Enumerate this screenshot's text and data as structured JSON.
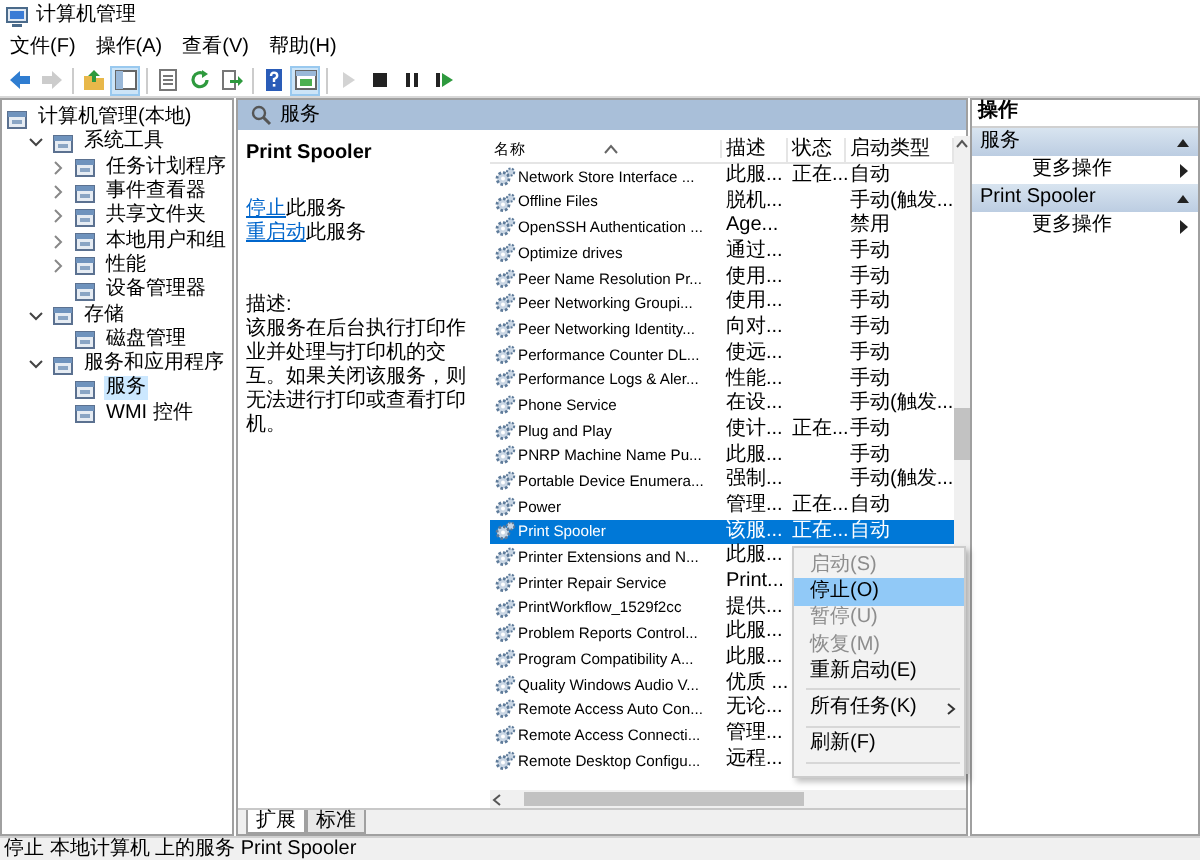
{
  "window": {
    "title": "计算机管理"
  },
  "menu": [
    "文件(F)",
    "操作(A)",
    "查看(V)",
    "帮助(H)"
  ],
  "toolbar": [
    {
      "kind": "back",
      "disabled": false,
      "pressed": false
    },
    {
      "kind": "forward",
      "disabled": true,
      "pressed": false
    },
    {
      "kind": "separator"
    },
    {
      "kind": "up",
      "disabled": false,
      "pressed": false
    },
    {
      "kind": "tree",
      "disabled": false,
      "pressed": true
    },
    {
      "kind": "separator"
    },
    {
      "kind": "properties",
      "disabled": false,
      "pressed": false
    },
    {
      "kind": "refresh",
      "disabled": false,
      "pressed": false
    },
    {
      "kind": "export",
      "disabled": false,
      "pressed": false
    },
    {
      "kind": "separator"
    },
    {
      "kind": "help",
      "disabled": false,
      "pressed": false
    },
    {
      "kind": "pane",
      "disabled": false,
      "pressed": true
    },
    {
      "kind": "separator"
    },
    {
      "kind": "start",
      "disabled": true,
      "pressed": false
    },
    {
      "kind": "stop",
      "disabled": false,
      "pressed": false
    },
    {
      "kind": "pause",
      "disabled": false,
      "pressed": false
    },
    {
      "kind": "restart",
      "disabled": false,
      "pressed": false
    }
  ],
  "tree": [
    {
      "label": "计算机管理(本地)",
      "selected": false,
      "children": [
        {
          "label": "系统工具",
          "expanded": true,
          "selected": false,
          "children": [
            {
              "label": "任务计划程序",
              "expanded": false,
              "selected": false
            },
            {
              "label": "事件查看器",
              "expanded": false,
              "selected": false
            },
            {
              "label": "共享文件夹",
              "expanded": false,
              "selected": false
            },
            {
              "label": "本地用户和组",
              "expanded": false,
              "selected": false
            },
            {
              "label": "性能",
              "expanded": false,
              "selected": false
            },
            {
              "label": "设备管理器",
              "selected": false
            }
          ]
        },
        {
          "label": "存储",
          "expanded": true,
          "selected": false,
          "children": [
            {
              "label": "磁盘管理",
              "selected": false
            }
          ]
        },
        {
          "label": "服务和应用程序",
          "expanded": true,
          "selected": false,
          "children": [
            {
              "label": "服务",
              "selected": true
            },
            {
              "label": "WMI 控件",
              "selected": false
            }
          ]
        }
      ]
    }
  ],
  "pane_title": "服务",
  "details": {
    "title": "Print Spooler",
    "actions": [
      {
        "link": "停止",
        "text": "此服务"
      },
      {
        "link": "重启动",
        "text": "此服务"
      }
    ],
    "description_label": "描述:",
    "description": "该服务在后台执行打印作业并处理与打印机的交互。如果关闭该服务，则无法进行打印或查看打印机。"
  },
  "columns": [
    "名称",
    "描述",
    "状态",
    "启动类型"
  ],
  "services": [
    {
      "name": "Network Store Interface ...",
      "description": "此服...",
      "status": "正在...",
      "startup": "自动",
      "selected": false
    },
    {
      "name": "Offline Files",
      "description": "脱机...",
      "startup": "手动(触发...",
      "selected": false
    },
    {
      "name": "OpenSSH Authentication ...",
      "description": "Age...",
      "startup": "禁用",
      "selected": false
    },
    {
      "name": "Optimize drives",
      "description": "通过...",
      "startup": "手动",
      "selected": false
    },
    {
      "name": "Peer Name Resolution Pr...",
      "description": "使用...",
      "startup": "手动",
      "selected": false
    },
    {
      "name": "Peer Networking Groupi...",
      "description": "使用...",
      "startup": "手动",
      "selected": false
    },
    {
      "name": "Peer Networking Identity...",
      "description": "向对...",
      "startup": "手动",
      "selected": false
    },
    {
      "name": "Performance Counter DL...",
      "description": "使远...",
      "startup": "手动",
      "selected": false
    },
    {
      "name": "Performance Logs & Aler...",
      "description": "性能...",
      "startup": "手动",
      "selected": false
    },
    {
      "name": "Phone Service",
      "description": "在设...",
      "startup": "手动(触发...",
      "selected": false
    },
    {
      "name": "Plug and Play",
      "description": "使计...",
      "status": "正在...",
      "startup": "手动",
      "selected": false
    },
    {
      "name": "PNRP Machine Name Pu...",
      "description": "此服...",
      "startup": "手动",
      "selected": false
    },
    {
      "name": "Portable Device Enumera...",
      "description": "强制...",
      "startup": "手动(触发...",
      "selected": false
    },
    {
      "name": "Power",
      "description": "管理...",
      "status": "正在...",
      "startup": "自动",
      "selected": false
    },
    {
      "name": "Print Spooler",
      "description": "该服...",
      "status": "正在...",
      "startup": "自动",
      "selected": true
    },
    {
      "name": "Printer Extensions and N...",
      "description": "此服...",
      "selected": false
    },
    {
      "name": "Printer Repair Service",
      "description": "Print...",
      "selected": false
    },
    {
      "name": "PrintWorkflow_1529f2cc",
      "description": "提供...",
      "selected": false
    },
    {
      "name": "Problem Reports Control...",
      "description": "此服...",
      "selected": false
    },
    {
      "name": "Program Compatibility A...",
      "description": "此服...",
      "selected": false
    },
    {
      "name": "Quality Windows Audio V...",
      "description": "优质 ...",
      "selected": false
    },
    {
      "name": "Remote Access Auto Con...",
      "description": "无论...",
      "selected": false
    },
    {
      "name": "Remote Access Connecti...",
      "description": "管理...",
      "selected": false
    },
    {
      "name": "Remote Desktop Configu...",
      "description": "远程...",
      "selected": false
    }
  ],
  "context_menu": [
    {
      "label": "启动(S)",
      "kind": "command",
      "disabled": true,
      "selected": false
    },
    {
      "label": "停止(O)",
      "kind": "command",
      "disabled": false,
      "selected": true
    },
    {
      "label": "暂停(U)",
      "kind": "command",
      "disabled": true,
      "selected": false
    },
    {
      "label": "恢复(M)",
      "kind": "command",
      "disabled": true,
      "selected": false
    },
    {
      "label": "重新启动(E)",
      "kind": "command",
      "disabled": false,
      "selected": false
    },
    {
      "kind": "separator"
    },
    {
      "label": "所有任务(K)",
      "kind": "submenu",
      "disabled": false,
      "selected": false
    },
    {
      "kind": "separator"
    },
    {
      "label": "刷新(F)",
      "kind": "command",
      "disabled": false,
      "selected": false
    },
    {
      "kind": "separator"
    }
  ],
  "view_tabs": [
    {
      "label": "扩展",
      "selected": true
    },
    {
      "label": "标准",
      "selected": false
    }
  ],
  "actions_pane": {
    "title": "操作",
    "sections": [
      {
        "title": "服务",
        "expanded": true,
        "items": [
          "更多操作"
        ]
      },
      {
        "title": "Print Spooler",
        "expanded": true,
        "items": [
          "更多操作"
        ]
      }
    ]
  },
  "status_bar": "停止 本地计算机 上的服务 Print Spooler"
}
